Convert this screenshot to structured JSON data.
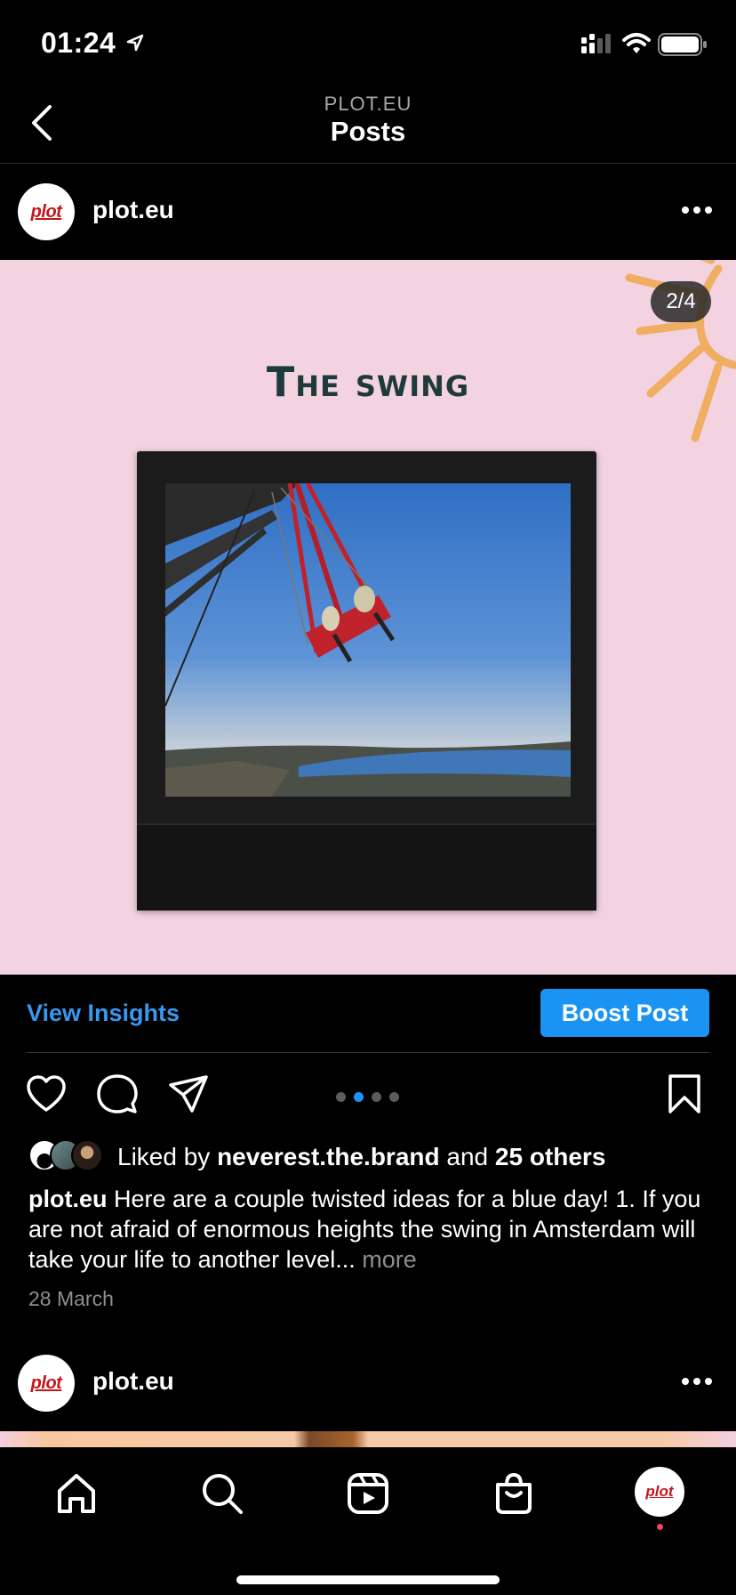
{
  "status_bar": {
    "time": "01:24"
  },
  "nav": {
    "account": "PLOT.EU",
    "title": "Posts"
  },
  "post": {
    "username": "plot.eu",
    "avatar_text": "plot",
    "slide_counter": "2/4",
    "slide_title": "The swing",
    "view_insights": "View Insights",
    "boost_post": "Boost Post",
    "carousel": {
      "total": 4,
      "active_index": 1
    },
    "liked_by_prefix": "Liked by",
    "liked_by_user": "neverest.the.brand",
    "liked_by_and": "and",
    "liked_by_others": "25 others",
    "caption_user": "plot.eu",
    "caption_text": "Here are a couple twisted ideas for a blue day! 1. If you are not afraid of enormous heights the swing in Amsterdam will take your life to another level...",
    "caption_more": "more",
    "date": "28 March"
  },
  "next_post": {
    "username": "plot.eu",
    "avatar_text": "plot"
  },
  "tabbar": {
    "items": [
      "home-icon",
      "search-icon",
      "reels-icon",
      "shop-icon",
      "profile-avatar"
    ],
    "profile_avatar_text": "plot"
  },
  "colors": {
    "accent": "#1a93f5",
    "link": "#3897f0",
    "media_bg": "#f4d3e1",
    "brand_red": "#c4161c"
  }
}
